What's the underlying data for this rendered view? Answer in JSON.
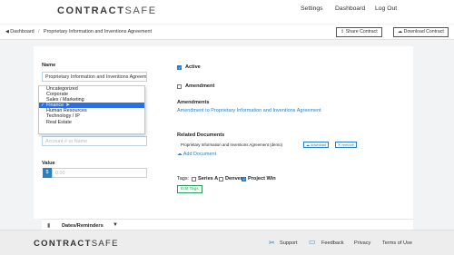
{
  "brand": {
    "name_main": "CONTRACT",
    "name_secondary": "SAFE"
  },
  "header_nav": {
    "settings": "Settings",
    "dashboard": "Dashboard",
    "logout": "Log Out"
  },
  "breadcrumb": {
    "home": "Dashboard",
    "separator": "/",
    "current": "Proprietary Information and Inventions Agreement"
  },
  "actions": {
    "share": "Share Contract",
    "download": "Download Contract"
  },
  "form": {
    "name_label": "Name",
    "name_value": "Proprietary Information and Inventions Agreem",
    "category_options": [
      "Uncategorized",
      "Corporate",
      "Sales / Marketing",
      "Finance",
      "Human Resources",
      "Technology / IP",
      "Real Estate"
    ],
    "selected_category": "Finance",
    "account_placeholder": "Account # or Name",
    "value_label": "Value",
    "currency_symbol": "$",
    "value_placeholder": "0.00"
  },
  "status": {
    "active_label": "Active",
    "active_checked": true,
    "amendment_label": "Amendment",
    "amendment_checked": false
  },
  "amendments": {
    "label": "Amendments",
    "link": "Amendment to Proprietary Information and Inventions Agreement"
  },
  "related": {
    "label": "Related Documents",
    "doc_name": "Proprietary Information and Inventions Agreement (demo)",
    "download_label": "download",
    "remove_label": "remove",
    "add_label": "Add Document"
  },
  "tags": {
    "label": "Tags:",
    "items": [
      {
        "name": "Series A",
        "checked": false
      },
      {
        "name": "Denver",
        "checked": false
      },
      {
        "name": "Project Win",
        "checked": true
      }
    ],
    "edit_label": "Edit Tags"
  },
  "dates_section": {
    "label": "Dates/Reminders"
  },
  "footer": {
    "support": "Support",
    "feedback": "Feedback",
    "privacy": "Privacy",
    "terms": "Terms of Use"
  },
  "colors": {
    "accent": "#2a7fc1",
    "selected": "#2e6fe0",
    "tag_green": "#2a9d5c"
  }
}
